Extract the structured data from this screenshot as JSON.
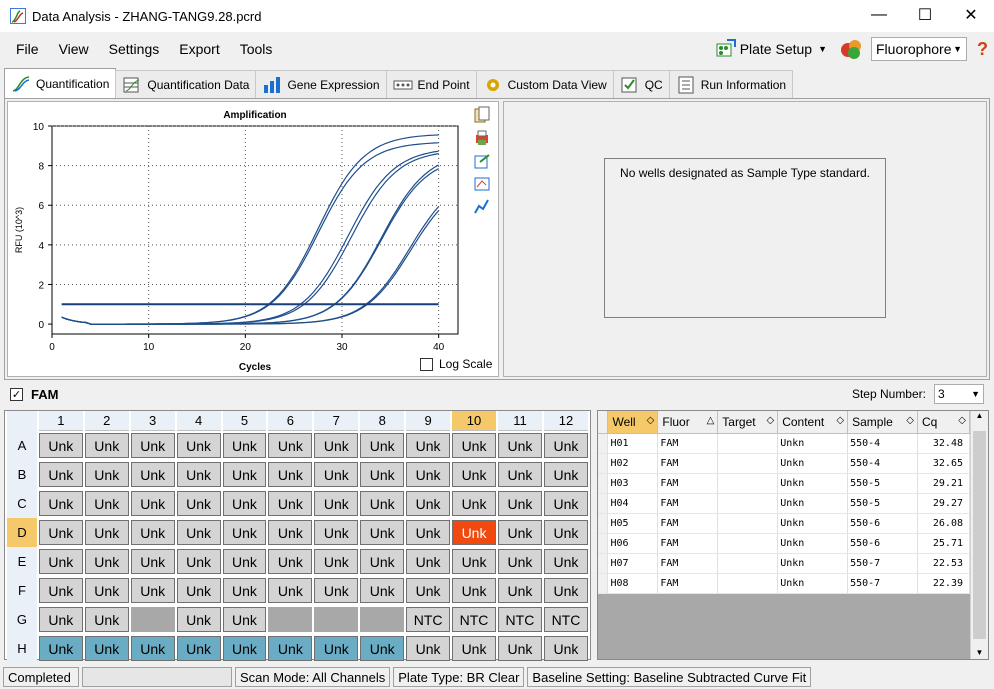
{
  "window": {
    "title": "Data Analysis - ZHANG-TANG9.28.pcrd",
    "minimize": "—",
    "maximize": "☐",
    "close": "✕"
  },
  "menu": [
    {
      "label": "File"
    },
    {
      "label": "View"
    },
    {
      "label": "Settings"
    },
    {
      "label": "Export"
    },
    {
      "label": "Tools"
    }
  ],
  "toolbar": {
    "plate_setup": "Plate Setup",
    "fluorophore": "Fluorophore",
    "help": "?"
  },
  "tabs": [
    {
      "label": "Quantification",
      "icon": "amplification-icon",
      "active": true
    },
    {
      "label": "Quantification Data",
      "icon": "quant-data-icon"
    },
    {
      "label": "Gene Expression",
      "icon": "bar-chart-icon"
    },
    {
      "label": "End Point",
      "icon": "end-point-icon"
    },
    {
      "label": "Custom Data View",
      "icon": "gear-icon"
    },
    {
      "label": "QC",
      "icon": "qc-icon"
    },
    {
      "label": "Run Information",
      "icon": "run-info-icon"
    }
  ],
  "standard_curve_message": "No wells designated as Sample Type standard.",
  "log_scale_label": "Log Scale",
  "fluor_filter": {
    "label": "FAM",
    "checked": true
  },
  "step_number": {
    "label": "Step Number:",
    "value": "3"
  },
  "chart_data": {
    "type": "line",
    "title": "Amplification",
    "xlabel": "Cycles",
    "ylabel": "RFU (10^3)",
    "xlim": [
      0,
      42
    ],
    "ylim": [
      -0.5,
      10
    ],
    "xticks": [
      0,
      10,
      20,
      30,
      40
    ],
    "yticks": [
      0,
      2,
      4,
      6,
      8,
      10
    ],
    "grid": true,
    "threshold": 1.0,
    "line_color": "#1f4e8c",
    "series": [
      {
        "cq": 22.39,
        "plateau": 9.6
      },
      {
        "cq": 22.53,
        "plateau": 9.2
      },
      {
        "cq": 25.71,
        "plateau": 8.9
      },
      {
        "cq": 26.08,
        "plateau": 8.8
      },
      {
        "cq": 29.21,
        "plateau": 8.7
      },
      {
        "cq": 29.27,
        "plateau": 8.5
      },
      {
        "cq": 32.48,
        "plateau": 7.6
      },
      {
        "cq": 32.65,
        "plateau": 7.4
      }
    ]
  },
  "plate": {
    "columns": [
      "1",
      "2",
      "3",
      "4",
      "5",
      "6",
      "7",
      "8",
      "9",
      "10",
      "11",
      "12"
    ],
    "selected_column": "10",
    "selected_row": "D",
    "rows": [
      {
        "label": "A",
        "wells": [
          "Unk",
          "Unk",
          "Unk",
          "Unk",
          "Unk",
          "Unk",
          "Unk",
          "Unk",
          "Unk",
          "Unk",
          "Unk",
          "Unk"
        ]
      },
      {
        "label": "B",
        "wells": [
          "Unk",
          "Unk",
          "Unk",
          "Unk",
          "Unk",
          "Unk",
          "Unk",
          "Unk",
          "Unk",
          "Unk",
          "Unk",
          "Unk"
        ]
      },
      {
        "label": "C",
        "wells": [
          "Unk",
          "Unk",
          "Unk",
          "Unk",
          "Unk",
          "Unk",
          "Unk",
          "Unk",
          "Unk",
          "Unk",
          "Unk",
          "Unk"
        ]
      },
      {
        "label": "D",
        "wells": [
          "Unk",
          "Unk",
          "Unk",
          "Unk",
          "Unk",
          "Unk",
          "Unk",
          "Unk",
          "Unk",
          "Unk",
          "Unk",
          "Unk"
        ]
      },
      {
        "label": "E",
        "wells": [
          "Unk",
          "Unk",
          "Unk",
          "Unk",
          "Unk",
          "Unk",
          "Unk",
          "Unk",
          "Unk",
          "Unk",
          "Unk",
          "Unk"
        ]
      },
      {
        "label": "F",
        "wells": [
          "Unk",
          "Unk",
          "Unk",
          "Unk",
          "Unk",
          "Unk",
          "Unk",
          "Unk",
          "Unk",
          "Unk",
          "Unk",
          "Unk"
        ]
      },
      {
        "label": "G",
        "wells": [
          "Unk",
          "Unk",
          "",
          "Unk",
          "Unk",
          "",
          "",
          "",
          "NTC",
          "NTC",
          "NTC",
          "NTC"
        ]
      },
      {
        "label": "H",
        "wells": [
          "Unk",
          "Unk",
          "Unk",
          "Unk",
          "Unk",
          "Unk",
          "Unk",
          "Unk",
          "Unk",
          "Unk",
          "Unk",
          "Unk"
        ]
      }
    ],
    "highlighted_wells": [
      "H1",
      "H2",
      "H3",
      "H4",
      "H5",
      "H6",
      "H7",
      "H8"
    ],
    "highlight_color": "#6aacc4",
    "selected_color": "#f24a0e"
  },
  "grid": {
    "headers": [
      "Well",
      "Fluor",
      "Target",
      "Content",
      "Sample",
      "Cq"
    ],
    "rows": [
      [
        "H01",
        "FAM",
        "",
        "Unkn",
        "550-4",
        "32.48"
      ],
      [
        "H02",
        "FAM",
        "",
        "Unkn",
        "550-4",
        "32.65"
      ],
      [
        "H03",
        "FAM",
        "",
        "Unkn",
        "550-5",
        "29.21"
      ],
      [
        "H04",
        "FAM",
        "",
        "Unkn",
        "550-5",
        "29.27"
      ],
      [
        "H05",
        "FAM",
        "",
        "Unkn",
        "550-6",
        "26.08"
      ],
      [
        "H06",
        "FAM",
        "",
        "Unkn",
        "550-6",
        "25.71"
      ],
      [
        "H07",
        "FAM",
        "",
        "Unkn",
        "550-7",
        "22.53"
      ],
      [
        "H08",
        "FAM",
        "",
        "Unkn",
        "550-7",
        "22.39"
      ]
    ]
  },
  "status": {
    "state": "Completed",
    "scan_mode": "Scan Mode: All Channels",
    "plate_type": "Plate Type: BR Clear",
    "baseline": "Baseline Setting: Baseline Subtracted Curve Fit"
  }
}
